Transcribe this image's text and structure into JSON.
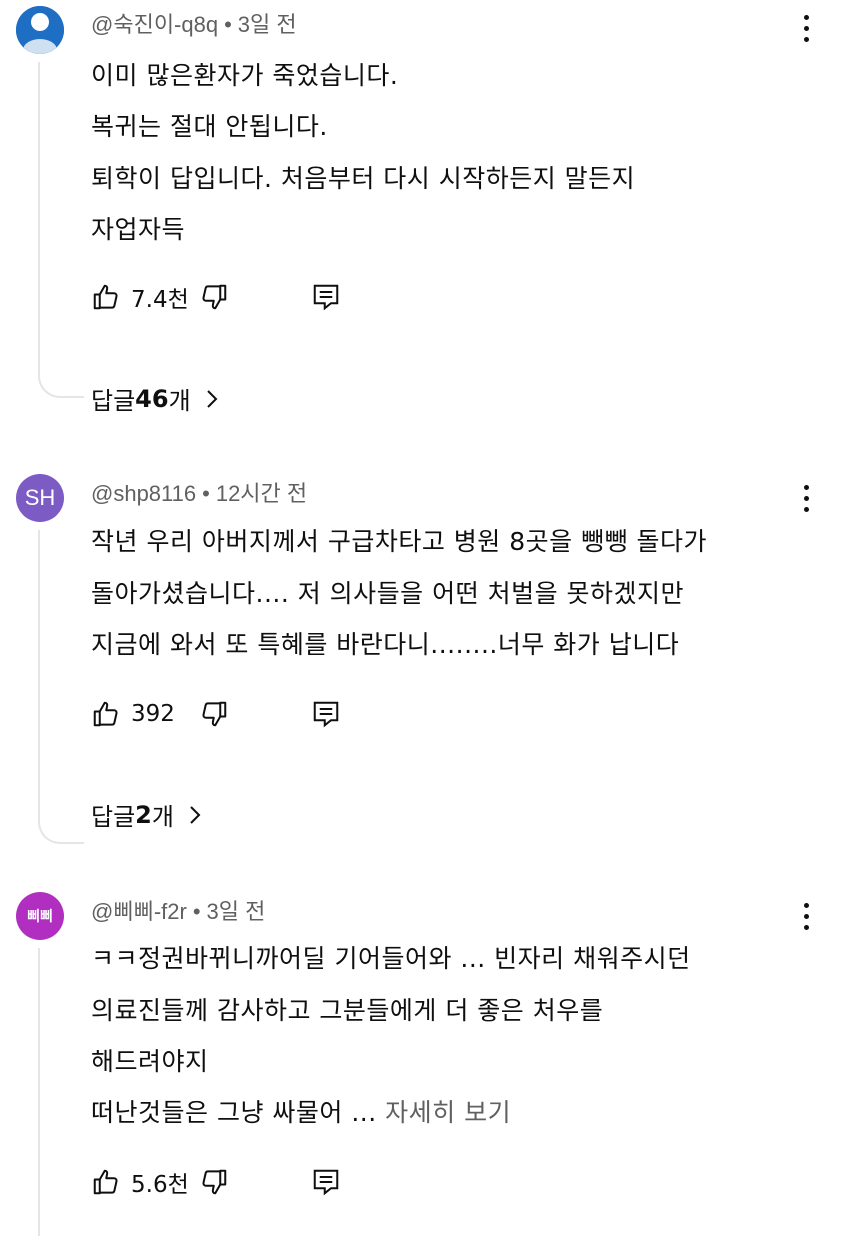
{
  "comments": [
    {
      "author": "@숙진이-q8q",
      "time": "3일 전",
      "lines": [
        "이미 많은환자가 죽었습니다.",
        "복귀는 절대 안됩니다.",
        "퇴학이 답입니다. 처음부터 다시 시작하든지 말든지",
        "자업자득"
      ],
      "likes": "7.4천",
      "replies_prefix": "답글 ",
      "replies_count": "46",
      "replies_suffix": "개"
    },
    {
      "author": "@shp8116",
      "avatar_text": "SH",
      "time": "12시간 전",
      "lines": [
        "작년 우리 아버지께서 구급차타고 병원 8곳을 뺑뺑 돌다가",
        "돌아가셨습니다.... 저 의사들을 어떤 처벌을 못하겠지만",
        "지금에 와서 또 특혜를 바란다니........너무 화가 납니다"
      ],
      "likes": "392",
      "replies_prefix": "답글 ",
      "replies_count": "2",
      "replies_suffix": "개"
    },
    {
      "author": "@삐삐-f2r",
      "avatar_text": "삐삐",
      "time": "3일 전",
      "lines": [
        "ㅋㅋ정권바뀌니까어딜 기어들어와 ... 빈자리 채워주시던",
        "의료진들께 감사하고 그분들에게 더 좋은 처우를",
        "해드려야지",
        "떠난것들은 그냥 싸물어 ... "
      ],
      "read_more": "자세히 보기",
      "likes": "5.6천"
    }
  ],
  "meta_separator": "•",
  "icons": {
    "like": "thumbs-up-icon",
    "dislike": "thumbs-down-icon",
    "reply": "reply-comment-icon",
    "more": "more-vertical-icon",
    "chevron": "chevron-right-icon",
    "default_avatar": "default-person-avatar"
  },
  "colors": {
    "secondary_text": "#606060",
    "thread_line": "#e5e5e5",
    "avatar_blue": "#1e6fc4",
    "avatar_purple": "#7c5cc4",
    "avatar_magenta": "#b02fc0"
  }
}
